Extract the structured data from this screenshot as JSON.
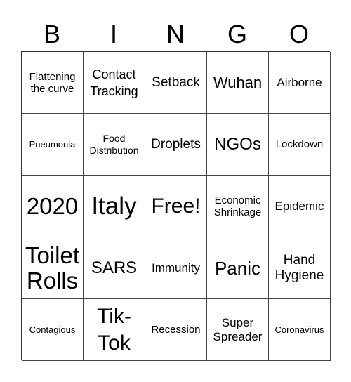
{
  "header": [
    "B",
    "I",
    "N",
    "G",
    "O"
  ],
  "cells": [
    "Flattening\nthe curve",
    "Contact\nTracking",
    "Setback",
    "Wuhan",
    "Airborne",
    "Pneumonia",
    "Food\nDistribution",
    "Droplets",
    "NGOs",
    "Lockdown",
    "2020",
    "Italy",
    "Free!",
    "Economic\nShrinkage",
    "Epidemic",
    "Toilet\nRolls",
    "SARS",
    "Immunity",
    "Panic",
    "Hand\nHygiene",
    "Contagious",
    "Tik-\nTok",
    "Recession",
    "Super\nSpreader",
    "Coronavirus"
  ]
}
